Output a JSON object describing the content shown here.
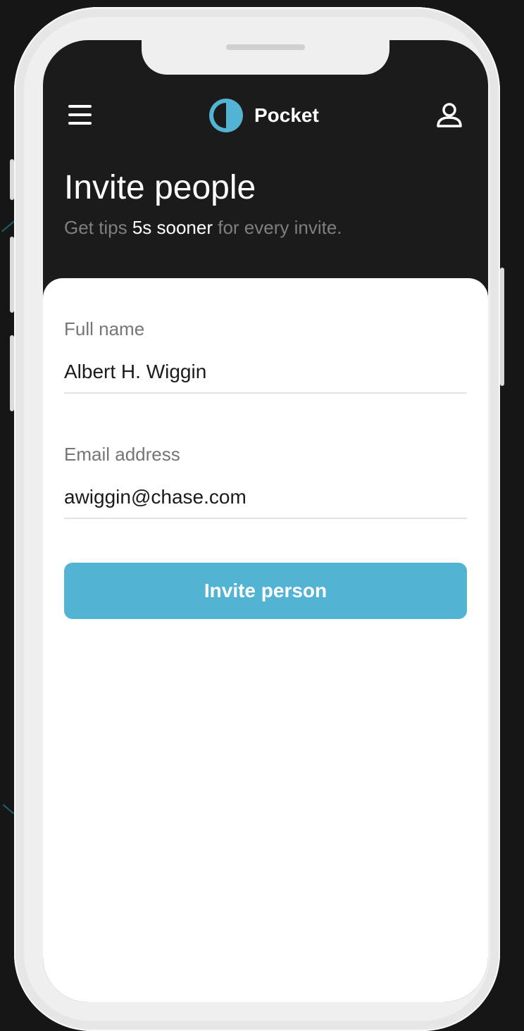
{
  "header": {
    "app_name": "Pocket",
    "menu_icon": "hamburger-menu-icon",
    "logo_icon": "half-circle-logo-icon",
    "profile_icon": "user-icon"
  },
  "intro": {
    "title": "Invite people",
    "subtitle_prefix": "Get tips ",
    "subtitle_highlight": "5s sooner",
    "subtitle_suffix": " for every invite."
  },
  "form": {
    "full_name": {
      "label": "Full name",
      "value": "Albert H. Wiggin"
    },
    "email": {
      "label": "Email address",
      "value": "awiggin@chase.com"
    },
    "submit_label": "Invite person"
  },
  "colors": {
    "accent": "#53b3d3",
    "header_background": "#1b1b1b",
    "card_background": "#ffffff",
    "muted_text": "#757575"
  }
}
